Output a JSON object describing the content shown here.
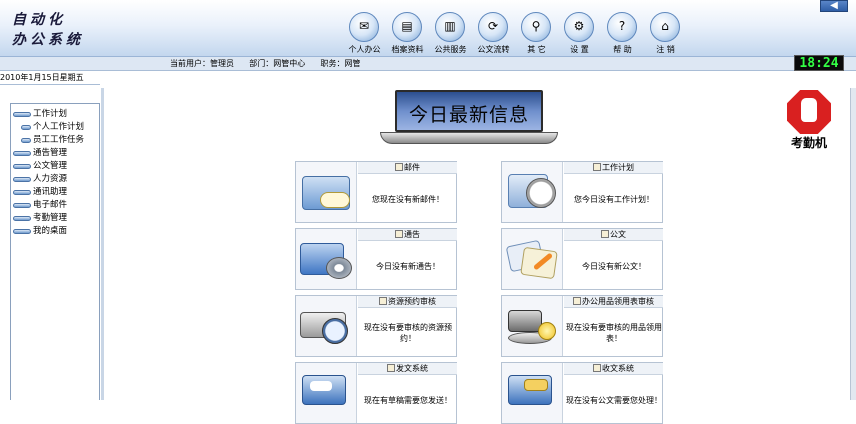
{
  "app": {
    "logo_line1": "自动化",
    "logo_line2": "办公系统"
  },
  "nav": [
    {
      "label": "个人办公",
      "icon": "globe-person-icon",
      "glyph": "✉"
    },
    {
      "label": "档案资料",
      "icon": "documents-icon",
      "glyph": "▤"
    },
    {
      "label": "公共服务",
      "icon": "books-icon",
      "glyph": "▥"
    },
    {
      "label": "公文流转",
      "icon": "envelope-flow-icon",
      "glyph": "⟳"
    },
    {
      "label": "其 它",
      "icon": "magnifier-icon",
      "glyph": "⚲"
    },
    {
      "label": "设 置",
      "icon": "gears-icon",
      "glyph": "⚙"
    },
    {
      "label": "帮 助",
      "icon": "help-icon",
      "glyph": "?"
    },
    {
      "label": "注 销",
      "icon": "home-logout-icon",
      "glyph": "⌂"
    }
  ],
  "header": {
    "user_info": "当前用户：管理员      部门：网管中心      职务：网管",
    "clock": "18:24",
    "date": "2010年1月15日星期五"
  },
  "sidebar": {
    "items": [
      {
        "label": "工作计划",
        "level": 0
      },
      {
        "label": "个人工作计划",
        "level": 1
      },
      {
        "label": "员工工作任务",
        "level": 1
      },
      {
        "label": "通告管理",
        "level": 0
      },
      {
        "label": "公文管理",
        "level": 0
      },
      {
        "label": "人力资源",
        "level": 0
      },
      {
        "label": "通讯助理",
        "level": 0
      },
      {
        "label": "电子邮件",
        "level": 0
      },
      {
        "label": "考勤管理",
        "level": 0
      },
      {
        "label": "我的桌面",
        "level": 0
      }
    ]
  },
  "main": {
    "banner": "今日最新信息",
    "stop_label": "考勤机",
    "cards": [
      {
        "title": "邮件",
        "message": "您现在没有新邮件！"
      },
      {
        "title": "工作计划",
        "message": "您今日没有工作计划！"
      },
      {
        "title": "通告",
        "message": "今日没有新通告！"
      },
      {
        "title": "公文",
        "message": "今日没有新公文！"
      },
      {
        "title": "资源预约审核",
        "message": "现在没有要审核的资源预约！"
      },
      {
        "title": "办公用品领用表审核",
        "message": "现在没有要审核的用品领用表！"
      },
      {
        "title": "发文系统",
        "message": "现在有草稿需要您发送！"
      },
      {
        "title": "收文系统",
        "message": "现在没有公文需要您处理！"
      }
    ]
  },
  "colors": {
    "header_gradient_end": "#c3d7ee",
    "clock_text": "#33ff44",
    "stop_sign": "#d92020"
  }
}
